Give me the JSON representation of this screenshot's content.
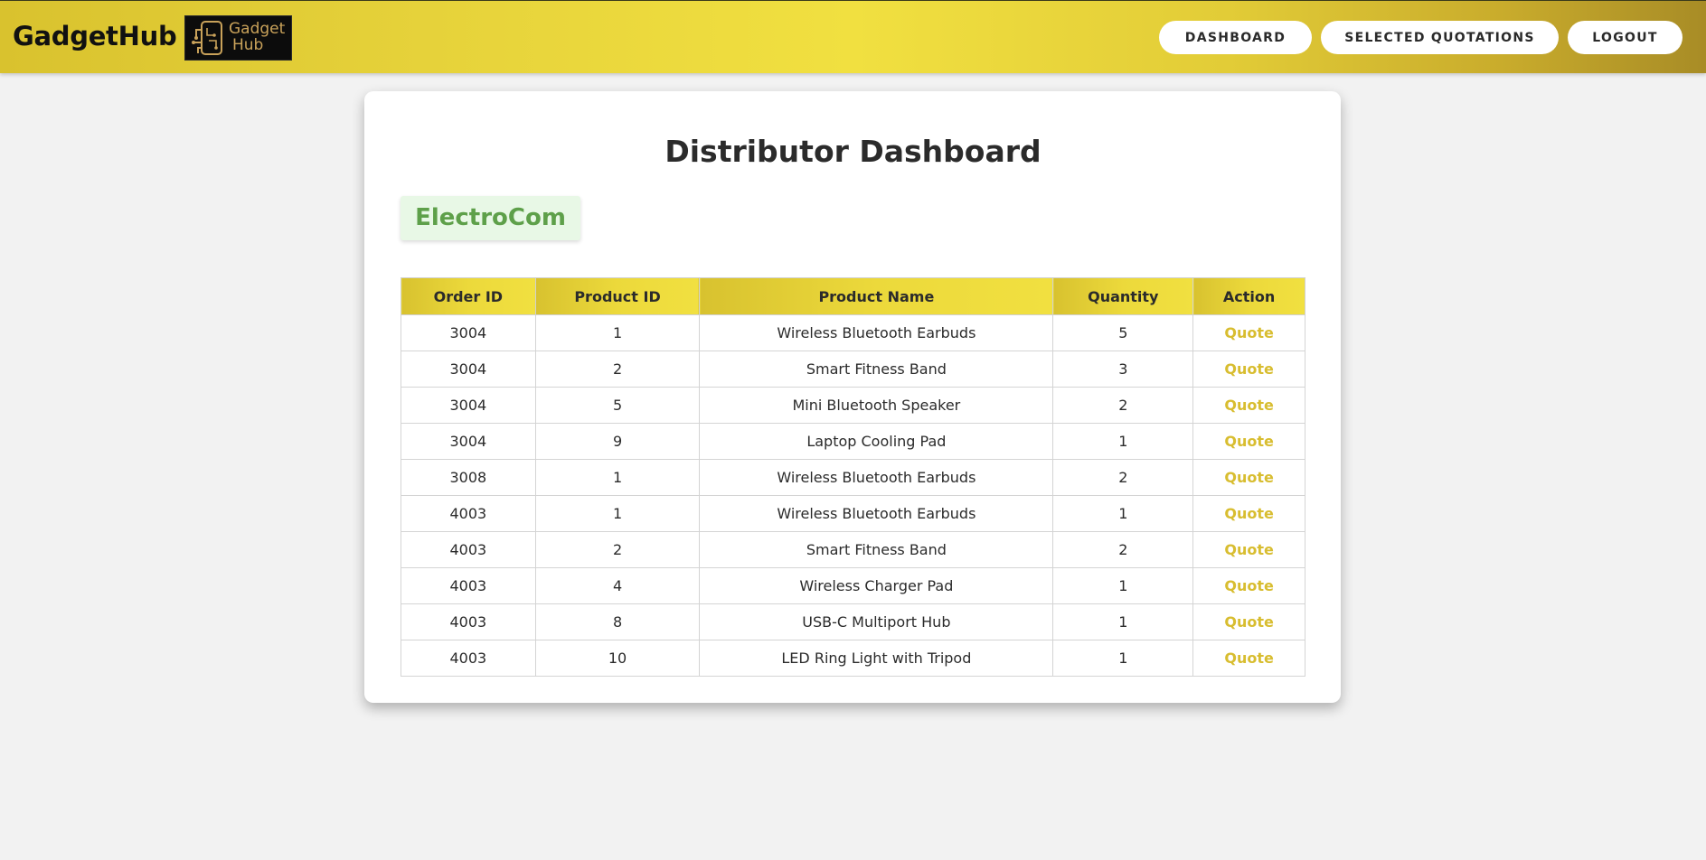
{
  "header": {
    "brand_name": "GadgetHub",
    "logo_text_line1": "Gadget",
    "logo_text_line2": "Hub",
    "nav": {
      "dashboard": "DASHBOARD",
      "selected_quotations": "SELECTED QUOTATIONS",
      "logout": "LOGOUT"
    }
  },
  "main": {
    "title": "Distributor Dashboard",
    "company": "ElectroCom"
  },
  "table": {
    "columns": [
      "Order ID",
      "Product ID",
      "Product Name",
      "Quantity",
      "Action"
    ],
    "rows": [
      {
        "order_id": "3004",
        "product_id": "1",
        "product_name": "Wireless Bluetooth Earbuds",
        "quantity": "5",
        "action": "Quote"
      },
      {
        "order_id": "3004",
        "product_id": "2",
        "product_name": "Smart Fitness Band",
        "quantity": "3",
        "action": "Quote"
      },
      {
        "order_id": "3004",
        "product_id": "5",
        "product_name": "Mini Bluetooth Speaker",
        "quantity": "2",
        "action": "Quote"
      },
      {
        "order_id": "3004",
        "product_id": "9",
        "product_name": "Laptop Cooling Pad",
        "quantity": "1",
        "action": "Quote"
      },
      {
        "order_id": "3008",
        "product_id": "1",
        "product_name": "Wireless Bluetooth Earbuds",
        "quantity": "2",
        "action": "Quote"
      },
      {
        "order_id": "4003",
        "product_id": "1",
        "product_name": "Wireless Bluetooth Earbuds",
        "quantity": "1",
        "action": "Quote"
      },
      {
        "order_id": "4003",
        "product_id": "2",
        "product_name": "Smart Fitness Band",
        "quantity": "2",
        "action": "Quote"
      },
      {
        "order_id": "4003",
        "product_id": "4",
        "product_name": "Wireless Charger Pad",
        "quantity": "1",
        "action": "Quote"
      },
      {
        "order_id": "4003",
        "product_id": "8",
        "product_name": "USB-C Multiport Hub",
        "quantity": "1",
        "action": "Quote"
      },
      {
        "order_id": "4003",
        "product_id": "10",
        "product_name": "LED Ring Light with Tripod",
        "quantity": "1",
        "action": "Quote"
      }
    ]
  },
  "colors": {
    "header_gradient_start": "#d9c22e",
    "header_gradient_mid": "#f1e040",
    "header_gradient_end": "#a88c26",
    "quote_link": "#d8bd30",
    "company_text": "#5ea04a",
    "company_bg": "#e8f8e6"
  },
  "icons": {
    "logo": "circuit-chip-icon"
  }
}
